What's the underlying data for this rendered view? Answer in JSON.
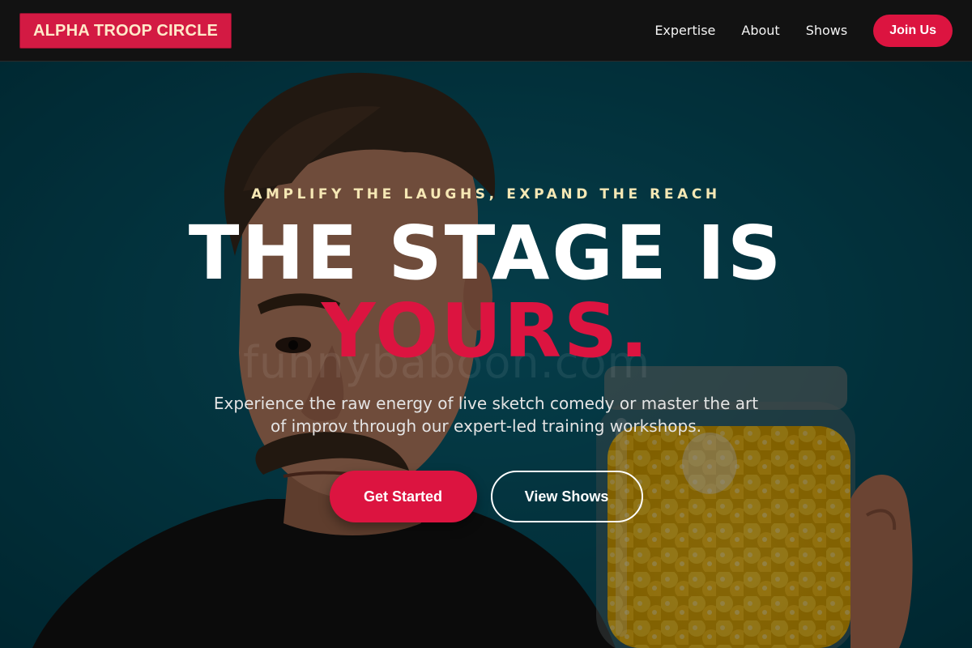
{
  "brand": {
    "name": "ALPHA TROOP CIRCLE",
    "accent_color": "#dc1440",
    "nav_background": "#121212",
    "hero_background": "#004a5c"
  },
  "nav": {
    "links": [
      {
        "label": "Expertise"
      },
      {
        "label": "About"
      },
      {
        "label": "Shows"
      }
    ],
    "cta_label": "Join Us"
  },
  "hero": {
    "tagline": "AMPLIFY THE LAUGHS, EXPAND THE REACH",
    "headline": "THE STAGE IS",
    "headline_accent": "YOURS.",
    "subtext": "Experience the raw energy of live sketch comedy or master the art of improv through our expert-led training workshops.",
    "primary_button": "Get Started",
    "secondary_button": "View Shows",
    "background_image": "man-with-mustache-holding-jar-of-yellow-candy-photo",
    "watermark": "funnybaboon.com"
  }
}
